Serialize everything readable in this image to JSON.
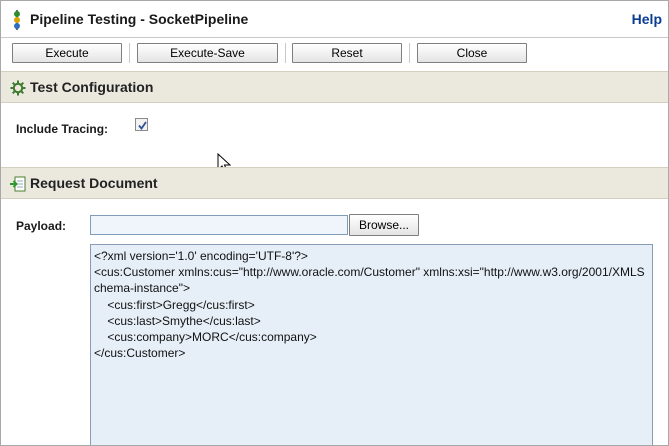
{
  "window": {
    "title": "Pipeline Testing - SocketPipeline",
    "help_label": "Help"
  },
  "toolbar": {
    "execute_label": "Execute",
    "execute_save_label": "Execute-Save",
    "reset_label": "Reset",
    "close_label": "Close"
  },
  "test_configuration": {
    "title": "Test Configuration",
    "include_tracing_label": "Include Tracing:",
    "include_tracing_checked": true
  },
  "request_document": {
    "title": "Request Document",
    "payload_label": "Payload:",
    "file_value": "",
    "browse_label": "Browse...",
    "payload_text": "<?xml version='1.0' encoding='UTF-8'?>\n<cus:Customer xmlns:cus=\"http://www.oracle.com/Customer\" xmlns:xsi=\"http://www.w3.org/2001/XMLSchema-instance\">\n    <cus:first>Gregg</cus:first>\n    <cus:last>Smythe</cus:last>\n    <cus:company>MORC</cus:company>\n</cus:Customer>"
  },
  "colors": {
    "section_header_bg": "#ebe9de",
    "payload_bg": "#e6eff8",
    "help_link": "#0b3d91"
  }
}
